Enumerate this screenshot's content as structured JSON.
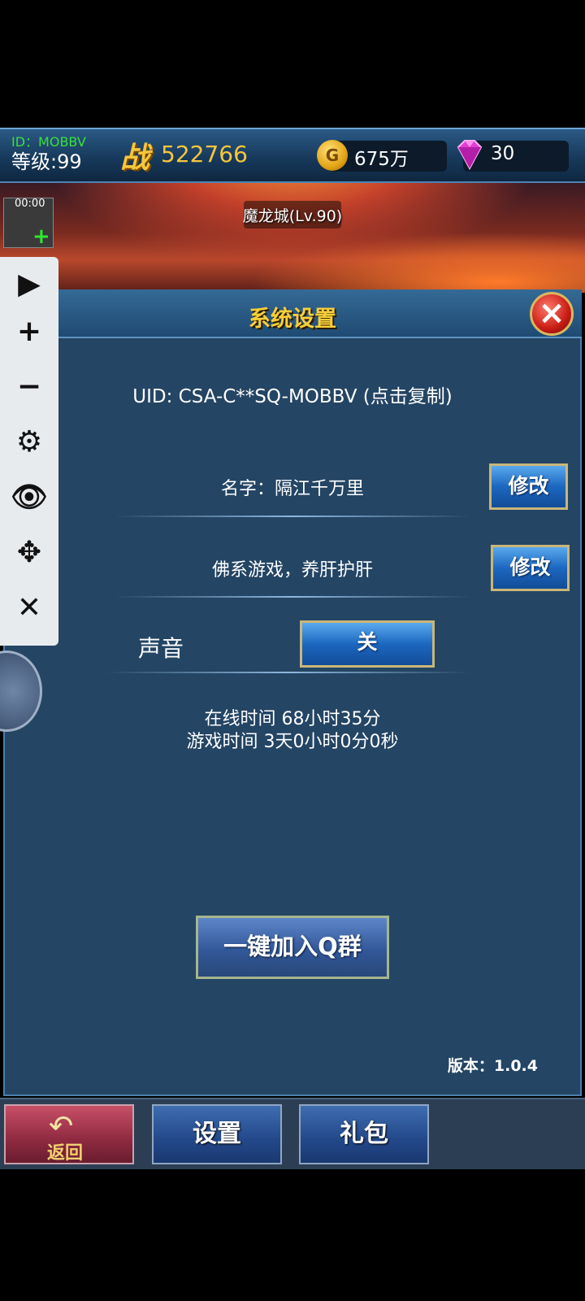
{
  "topbar": {
    "player_id": "ID：MOBBV",
    "level": "等级:99",
    "power_glyph": "战",
    "power": "522766",
    "gold_glyph": "G",
    "gold": "675万",
    "gems": "30"
  },
  "scene": {
    "title": "魔龙城(Lv.90)",
    "timer": "00:00"
  },
  "panel": {
    "title": "系统设置",
    "uid": "UID: CSA-C**SQ-MOBBV (点击复制)",
    "name": "名字：隔江千万里",
    "edit_label": "修改",
    "motto": "佛系游戏，养肝护肝",
    "sound_label": "声音",
    "sound_state": "关",
    "online_time": "在线时间 68小时35分",
    "game_time": "游戏时间 3天0小时0分0秒",
    "qq_button": "一键加入Q群",
    "version": "版本：1.0.4"
  },
  "bottom": {
    "back_label": "返回",
    "settings_label": "设置",
    "gift_label": "礼包"
  },
  "toolbar": {
    "icons": [
      "play-icon",
      "plus-icon",
      "minus-icon",
      "gear-icon",
      "eye-icon",
      "move-icon",
      "close-icon"
    ]
  }
}
